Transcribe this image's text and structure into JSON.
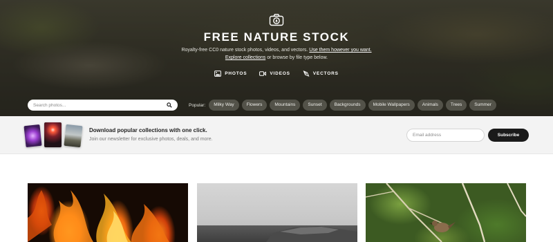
{
  "hero": {
    "title": "FREE NATURE STOCK",
    "subtitle_text": "Royalty-free CC0 nature stock photos, videos, and vectors.",
    "subtitle_link": "Use them however you want.",
    "explore_link": "Explore collections",
    "explore_suffix": "or browse by file type below.",
    "types": [
      {
        "label": "PHOTOS",
        "icon": "image-icon"
      },
      {
        "label": "VIDEOS",
        "icon": "video-icon"
      },
      {
        "label": "VECTORS",
        "icon": "vector-pen-icon"
      }
    ]
  },
  "search": {
    "placeholder": "Search photos..."
  },
  "popular": {
    "label": "Popular:",
    "tags": [
      "Milky Way",
      "Flowers",
      "Mountains",
      "Sunset",
      "Backgrounds",
      "Mobile Wallpapers",
      "Animals",
      "Trees",
      "Summer"
    ]
  },
  "newsletter": {
    "title": "Download popular collections with one click.",
    "subtitle": "Join our newsletter for exclusive photos, deals, and more.",
    "email_placeholder": "Email address",
    "subscribe_label": "Subscribe"
  },
  "gallery": [
    "fire-photo",
    "mountain-photo",
    "bird-photo"
  ]
}
